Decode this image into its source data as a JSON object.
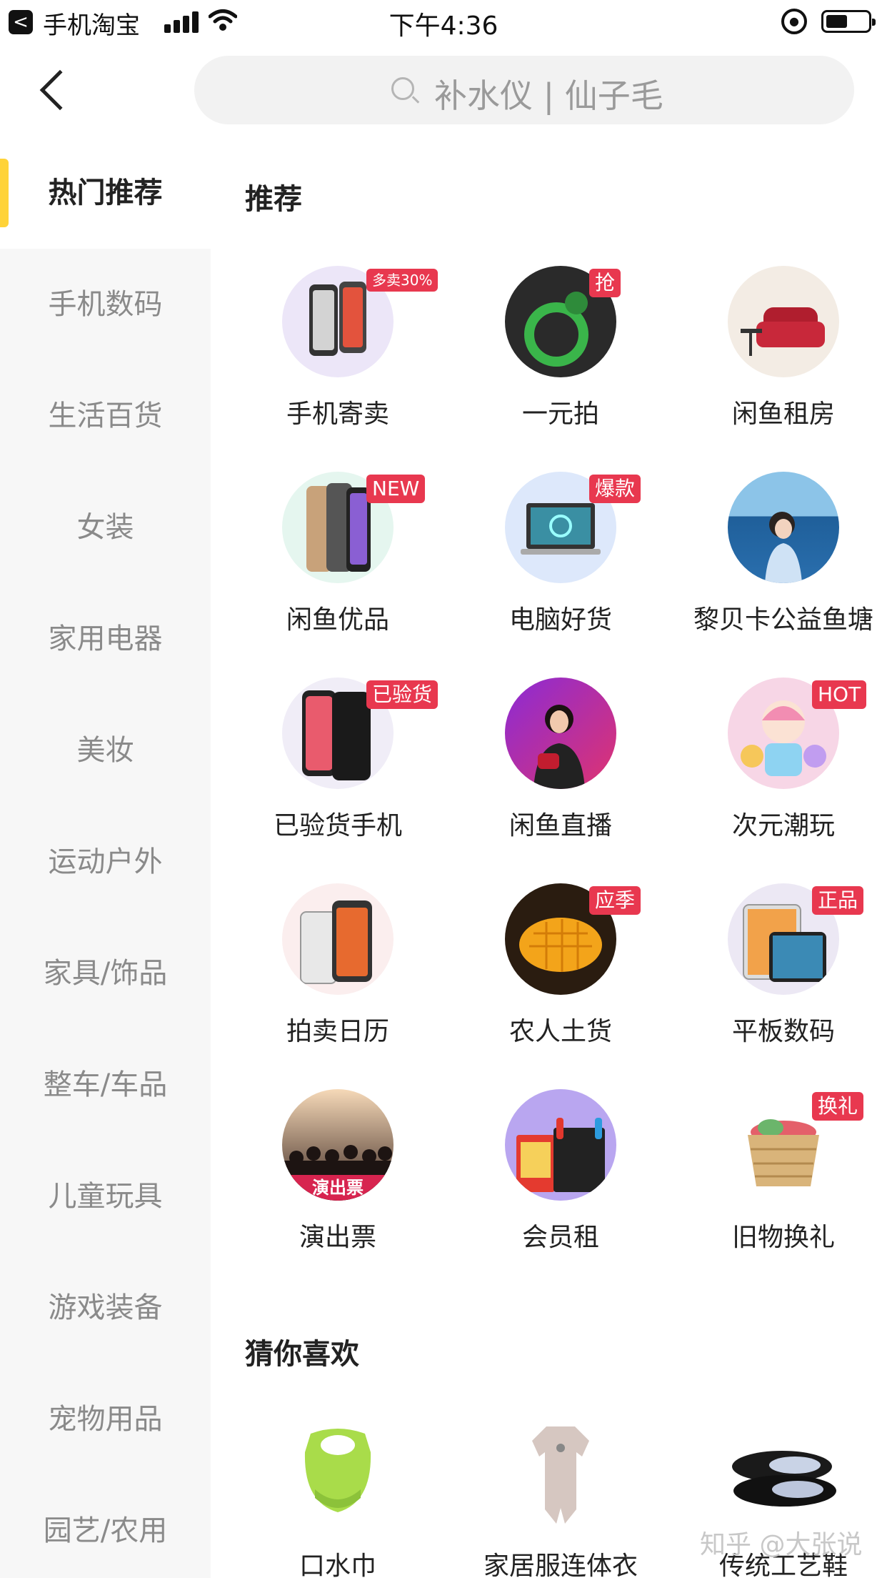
{
  "status_bar": {
    "back_glyph": "<",
    "app_name": "手机淘宝",
    "time": "下午4:36",
    "battery_fraction": 0.5,
    "icons": [
      "signal-icon",
      "wifi-icon",
      "rotation-lock-icon",
      "battery-icon"
    ]
  },
  "header": {
    "search_placeholder": "补水仪 | 仙子毛"
  },
  "sidebar": {
    "items": [
      {
        "label": "热门推荐",
        "active": true
      },
      {
        "label": "手机数码"
      },
      {
        "label": "生活百货"
      },
      {
        "label": "女装"
      },
      {
        "label": "家用电器"
      },
      {
        "label": "美妆"
      },
      {
        "label": "运动户外"
      },
      {
        "label": "家具/饰品"
      },
      {
        "label": "整车/车品"
      },
      {
        "label": "儿童玩具"
      },
      {
        "label": "游戏装备"
      },
      {
        "label": "宠物用品"
      },
      {
        "label": "园艺/农用"
      }
    ]
  },
  "recommend": {
    "title": "推荐",
    "items": [
      {
        "label": "手机寄卖",
        "tag": "多卖30%"
      },
      {
        "label": "一元拍",
        "tag": "抢"
      },
      {
        "label": "闲鱼租房",
        "tag": ""
      },
      {
        "label": "闲鱼优品",
        "tag": "NEW"
      },
      {
        "label": "电脑好货",
        "tag": "爆款"
      },
      {
        "label": "黎贝卡公益鱼塘",
        "tag": ""
      },
      {
        "label": "已验货手机",
        "tag": "已验货"
      },
      {
        "label": "闲鱼直播",
        "tag": ""
      },
      {
        "label": "次元潮玩",
        "tag": "HOT"
      },
      {
        "label": "拍卖日历",
        "tag": ""
      },
      {
        "label": "农人土货",
        "tag": "应季"
      },
      {
        "label": "平板数码",
        "tag": "正品"
      },
      {
        "label": "演出票",
        "tag": "",
        "overlay": "演出票"
      },
      {
        "label": "会员租",
        "tag": ""
      },
      {
        "label": "旧物换礼",
        "tag": "换礼"
      }
    ]
  },
  "guess": {
    "title": "猜你喜欢",
    "items": [
      {
        "label": "口水巾"
      },
      {
        "label": "家居服连体衣"
      },
      {
        "label": "传统工艺鞋"
      }
    ]
  },
  "watermark": "知乎 @大张说",
  "colors": {
    "accent": "#ffd338",
    "tag": "#e8384f",
    "sidebar_bg": "#f7f7f7",
    "search_bg": "#f2f2f2"
  }
}
